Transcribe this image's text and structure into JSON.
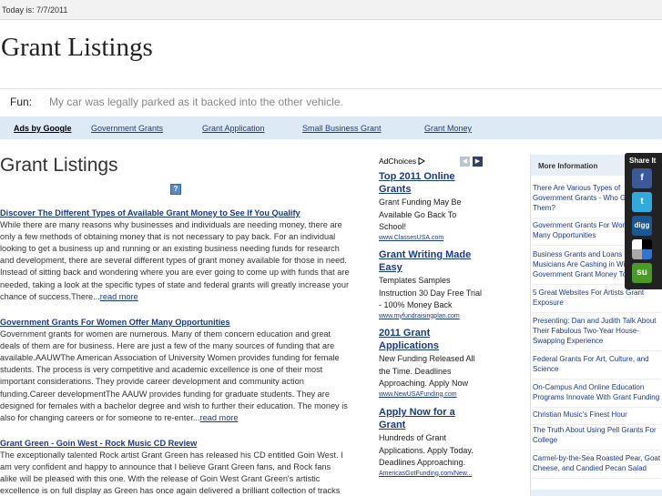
{
  "date_line": "Today is: 7/7/2011",
  "site_title": "Grant Listings",
  "fun": {
    "label": "Fun:",
    "text": "My car was legally parked as it backed into the other vehicle."
  },
  "adsbar": {
    "ads_by_google": "Ads by Google",
    "links": [
      "Government Grants",
      "Grant Application",
      "Small Business Grant",
      "Grant Money"
    ]
  },
  "main": {
    "heading": "Grant Listings",
    "help_icon": "?",
    "articles": [
      {
        "title": "Discover The Different Types of Available Grant Money to See If You Qualify",
        "body": "While there are many reasons why businesses and individuals are needing money, there are only a few methods of obtaining money that is not necessary to pay back. For an individual looking to get a business up and running or an existing business needing funds for research and development, there are several different types of grant money available for those in need. Instead of sitting back and wondering where you are ever going to come up with funds that are needed, taking a look at the specific types of state and federal grants will greatly increase your chance of success.There...",
        "more": "read more"
      },
      {
        "title": "Government Grants For Women Offer Many Opportunities",
        "body": "Government grants for women are numerous. Many of them concern education and great deals of them are for business. Here are just a few of the many sources of funding that are available.AAUWThe American Association of University Women provides funding for female students. The process is very competitive and academic excellence is one of their most important considerations. They provide career development and community action funding.Career developmentThe AAUW provides funding for graduate students. They are designed for females with a bachelor degree and wish to further their education. The money is also for changing careers or for someone to re-enter...",
        "more": "read more"
      },
      {
        "title": "Grant Green - Goin West - Rock Music CD Review",
        "body": "The exceptionally talented Rock artist Grant Green has released his CD entitled Goin West. I am very confident and happy to announce that I believe Grant Green fans, and Rock fans alike will be pleased with this one. With the release of Goin West Grant Green's artistic excellence is on full display as Green has once again delivered a brilliant collection of tracks that could very well",
        "more": ""
      }
    ]
  },
  "ad_column": {
    "adchoices": "AdChoices",
    "adchoices_icon": "adchoices-triangle-icon",
    "prev_icon": "chevron-left-icon",
    "next_icon": "chevron-right-icon",
    "ads": [
      {
        "headline": "Top 2011 Online Grants",
        "body": "Grant Funding May Be Available Go Back To School!",
        "url": "www.ClassesUSA.com"
      },
      {
        "headline": "Grant Writing Made Easy",
        "body": "Templates Samples Instruction 30 Day Free Trial - 100% Money Back",
        "url": "www.myfundraisingplan.com"
      },
      {
        "headline": "2011 Grant Applications",
        "body": "New Funding Released All the Time. Deadlines Approaching. Apply Now",
        "url": "www.NewUSAFunding.com"
      },
      {
        "headline": "Apply Now for a Grant",
        "body": "Hundreds of Grant Applications. Apply Today. Deadlines Approaching.",
        "url": "AmericasGotFunding.com/New..."
      }
    ]
  },
  "sidebar": {
    "heading": "More Information",
    "links": [
      "There Are Various Types of Government Grants - Who Gets From Them?",
      "Government Grants For Women Offer Many Opportunities",
      "Business Grants and Loans - How Musicians Are Cashing in With Government Grant Money Too",
      "5 Great Websites For Artists Grant Exposure",
      "Presenting: Dan and Judith Talk About Their Fabulous Two-Year House-Swapping Experience",
      "Federal Grants For Art, Culture, and Science",
      "On-Campus And Online Education Programs Innovate With Grant Funding",
      "Christian Music's Finest Hour",
      "The Truth About Using Pell Grants For College",
      "Carmel-by-the-Sea Roasted Pear, Goat Cheese, and Candied Pecan Salad"
    ]
  },
  "share": {
    "label": "Share It",
    "items": [
      {
        "name": "facebook-icon",
        "glyph": "f",
        "color": "#3b5998"
      },
      {
        "name": "twitter-icon",
        "glyph": "t",
        "color": "#33aadd"
      },
      {
        "name": "digg-icon",
        "glyph": "digg",
        "color": "#1b5891"
      },
      {
        "name": "delicious-icon",
        "glyph": "",
        "color": "#3274d1"
      },
      {
        "name": "stumbleupon-icon",
        "glyph": "su",
        "color": "#4a9a2a"
      }
    ]
  },
  "colors": {
    "link": "#1a3a8a",
    "adsbar_bg": "#ddeaf5",
    "sidebar_header_bg": "#e8eef5"
  }
}
